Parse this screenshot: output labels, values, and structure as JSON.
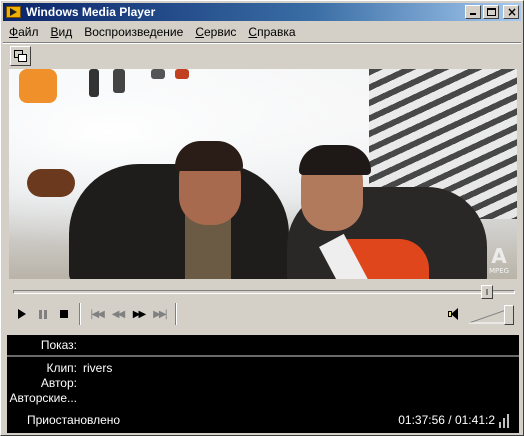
{
  "window": {
    "title": "Windows Media Player"
  },
  "menu": [
    {
      "label": "Файл",
      "underline": "Ф",
      "rest": "айл"
    },
    {
      "label": "Вид",
      "underline": "В",
      "rest": "ид"
    },
    {
      "label": "Воспроизведение",
      "underline": "",
      "rest": "Воспроизведение"
    },
    {
      "label": "Сервис",
      "underline": "С",
      "rest": "ервис"
    },
    {
      "label": "Справка",
      "underline": "С",
      "rest": "правка"
    }
  ],
  "seek": {
    "position_fraction": 0.956
  },
  "volume": {
    "level_fraction": 1.0
  },
  "info": {
    "show_label": "Показ:",
    "show_value": "",
    "clip_label": "Клип:",
    "clip_value": "rivers",
    "author_label": "Автор:",
    "author_value": "",
    "copyright_label": "Авторские...",
    "copyright_value": ""
  },
  "status": {
    "state": "Приостановлено",
    "time": "01:37:56 / 01:41:2"
  },
  "video": {
    "badge": "MPEG"
  }
}
